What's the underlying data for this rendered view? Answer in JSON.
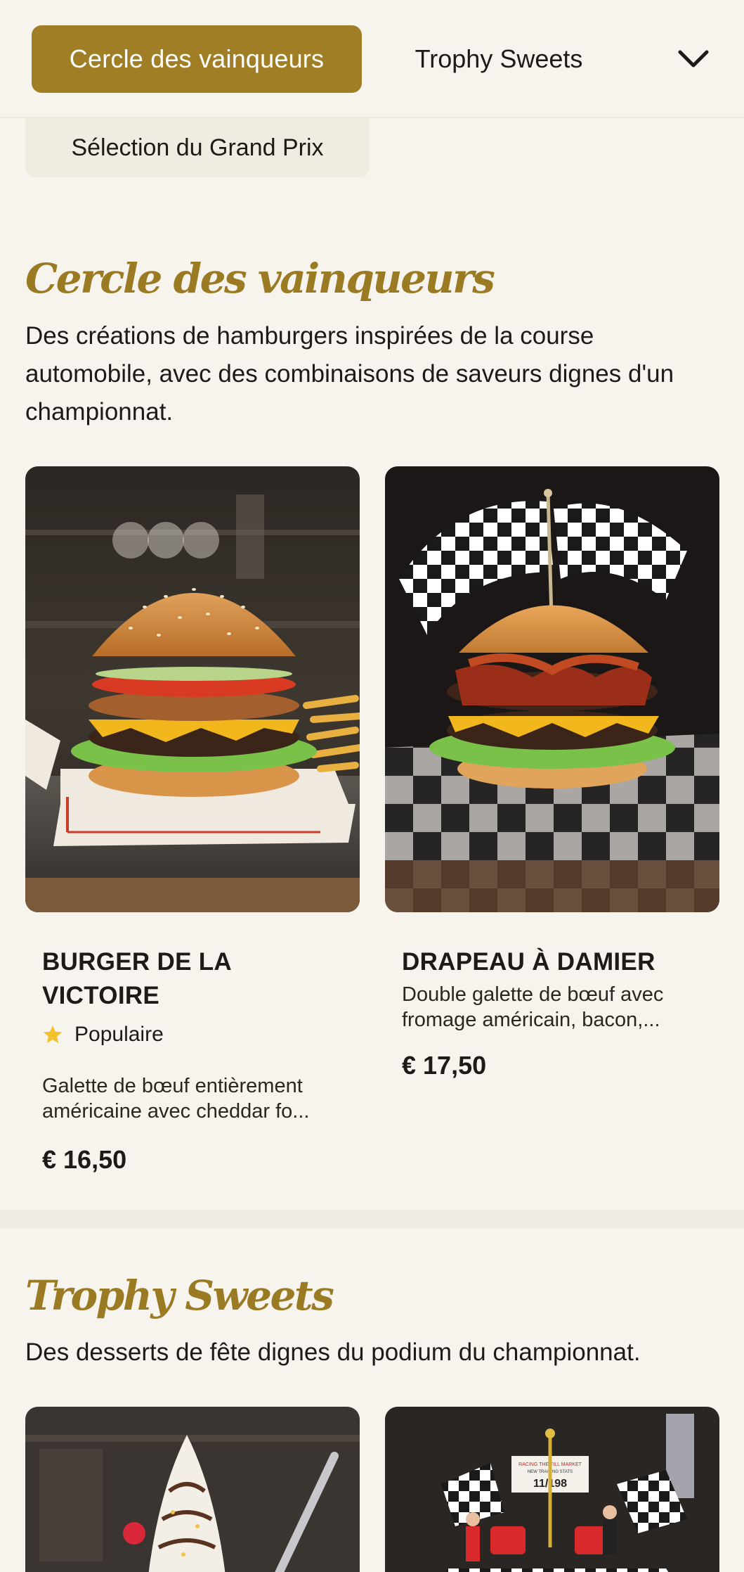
{
  "nav": {
    "active_tab": "Cercle des vainqueurs",
    "second_tab": "Trophy Sweets",
    "secondary_tab": "Sélection du Grand Prix"
  },
  "sections": [
    {
      "title": "Cercle des vainqueurs",
      "description": "Des créations de hamburgers inspirées de la course automobile, avec des combinaisons de saveurs dignes d'un championnat.",
      "items": [
        {
          "name": "BURGER DE LA VICTOIRE",
          "badge": "Populaire",
          "description": "Galette de bœuf entièrement américaine avec cheddar fo...",
          "price": "€ 16,50"
        },
        {
          "name": "DRAPEAU À DAMIER",
          "description": "Double galette de bœuf avec fromage américain, bacon,...",
          "price": "€ 17,50"
        }
      ]
    },
    {
      "title": "Trophy Sweets",
      "description": "Des desserts de fête dignes du podium du championnat.",
      "items": [
        {
          "image_sign": "RACING THE FILL MARKET\nNEW TRAINING STATS\n11/198"
        }
      ]
    }
  ],
  "colors": {
    "accent": "#a07e25",
    "title": "#9a7a22",
    "background": "#f7f4ee"
  }
}
